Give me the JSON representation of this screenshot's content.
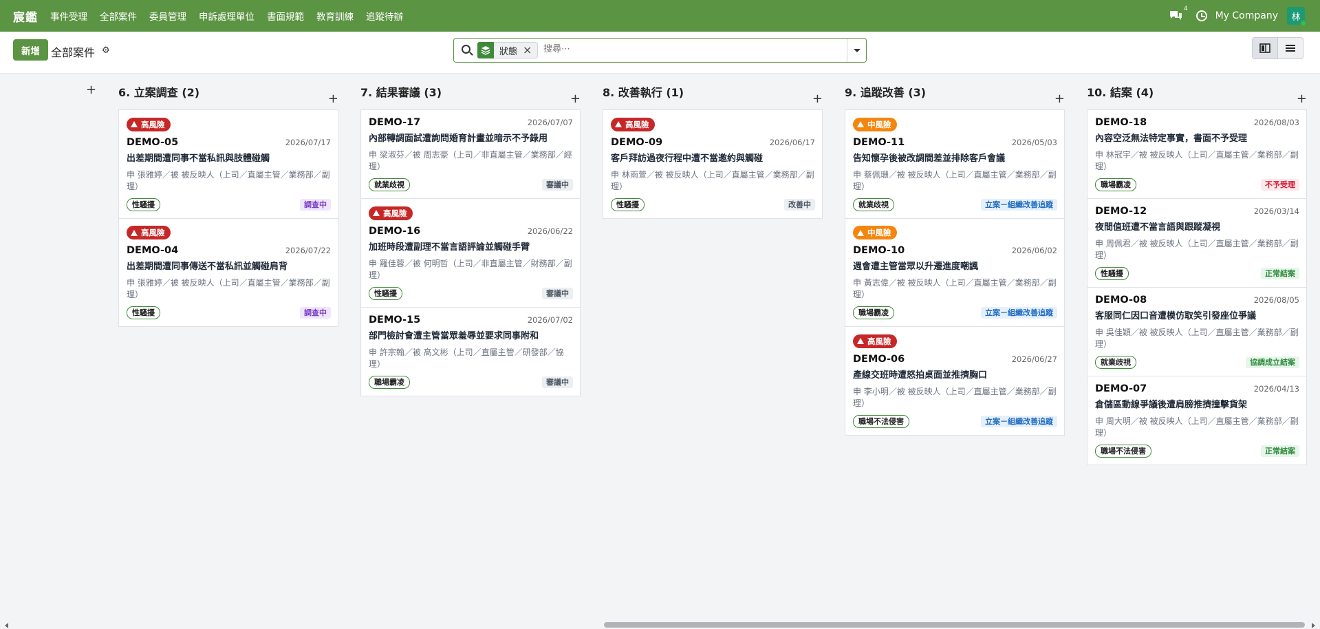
{
  "nav": {
    "brand": "宸鑑",
    "menu": [
      "事件受理",
      "全部案件",
      "委員管理",
      "申訴處理單位",
      "書面規範",
      "教育訓練",
      "追蹤待辦"
    ],
    "chat_count": "4",
    "company": "My Company",
    "avatar": "林"
  },
  "control": {
    "new_label": "新增",
    "title": "全部案件",
    "facet_label": "狀態",
    "search_placeholder": "搜尋⋯"
  },
  "columns": [
    {
      "title": "6. 立案調查 (2)",
      "cards": [
        {
          "risk": "高風險",
          "risk_level": "high",
          "id": "DEMO-05",
          "date": "2026/07/17",
          "title": "出差期間遭同事不當私訊與肢體碰觸",
          "meta": "申 張雅婷／被 被反映人（上司／直屬主管／業務部／副理）",
          "tag": "性騷擾",
          "status": "調查中",
          "status_kind": "inv"
        },
        {
          "risk": "高風險",
          "risk_level": "high",
          "id": "DEMO-04",
          "date": "2026/07/22",
          "title": "出差期間遭同事傳送不當私訊並觸碰肩背",
          "meta": "申 張雅婷／被 被反映人（上司／直屬主管／業務部／副理）",
          "tag": "性騷擾",
          "status": "調查中",
          "status_kind": "inv"
        }
      ]
    },
    {
      "title": "7. 結果審議 (3)",
      "cards": [
        {
          "risk": "",
          "risk_level": "",
          "id": "DEMO-17",
          "date": "2026/07/07",
          "title": "內部轉調面試遭詢問婚育計畫並暗示不予錄用",
          "meta": "申 梁淑芬／被 周志豪（上司／非直屬主管／業務部／經理）",
          "tag": "就業歧視",
          "status": "審議中",
          "status_kind": "rev"
        },
        {
          "risk": "高風險",
          "risk_level": "high",
          "id": "DEMO-16",
          "date": "2026/06/22",
          "title": "加班時段遭副理不當言語評論並觸碰手臂",
          "meta": "申 羅佳蓉／被 何明哲（上司／非直屬主管／財務部／副理）",
          "tag": "性騷擾",
          "status": "審議中",
          "status_kind": "rev"
        },
        {
          "risk": "",
          "risk_level": "",
          "id": "DEMO-15",
          "date": "2026/07/02",
          "title": "部門檢討會遭主管當眾羞辱並要求同事附和",
          "meta": "申 許宗翰／被 高文彬（上司／直屬主管／研發部／協理）",
          "tag": "職場霸凌",
          "status": "審議中",
          "status_kind": "rev"
        }
      ]
    },
    {
      "title": "8. 改善執行 (1)",
      "cards": [
        {
          "risk": "高風險",
          "risk_level": "high",
          "id": "DEMO-09",
          "date": "2026/06/17",
          "title": "客戶拜訪過夜行程中遭不當邀約與觸碰",
          "meta": "申 林雨萱／被 被反映人（上司／直屬主管／業務部／副理）",
          "tag": "性騷擾",
          "status": "改善中",
          "status_kind": "imp"
        }
      ]
    },
    {
      "title": "9. 追蹤改善 (3)",
      "cards": [
        {
          "risk": "中風險",
          "risk_level": "med",
          "id": "DEMO-11",
          "date": "2026/05/03",
          "title": "告知懷孕後被改調間差並排除客戶會議",
          "meta": "申 蔡佩珊／被 被反映人（上司／直屬主管／業務部／副理）",
          "tag": "就業歧視",
          "status": "立案－組織改善追蹤",
          "status_kind": "trk"
        },
        {
          "risk": "中風險",
          "risk_level": "med",
          "id": "DEMO-10",
          "date": "2026/06/02",
          "title": "週會遭主管當眾以升遷進度嘲諷",
          "meta": "申 黃志偉／被 被反映人（上司／直屬主管／業務部／副理）",
          "tag": "職場霸凌",
          "status": "立案－組織改善追蹤",
          "status_kind": "trk"
        },
        {
          "risk": "高風險",
          "risk_level": "high",
          "id": "DEMO-06",
          "date": "2026/06/27",
          "title": "產線交班時遭怒拍桌面並推擠胸口",
          "meta": "申 李小明／被 被反映人（上司／直屬主管／業務部／副理）",
          "tag": "職場不法侵害",
          "status": "立案－組織改善追蹤",
          "status_kind": "trk"
        }
      ]
    },
    {
      "title": "10. 結案 (4)",
      "cards": [
        {
          "risk": "",
          "risk_level": "",
          "id": "DEMO-18",
          "date": "2026/08/03",
          "title": "內容空泛無法特定事實，書面不予受理",
          "meta": "申 林冠宇／被 被反映人（上司／直屬主管／業務部／副理）",
          "tag": "職場霸凌",
          "status": "不予受理",
          "status_kind": "rej"
        },
        {
          "risk": "",
          "risk_level": "",
          "id": "DEMO-12",
          "date": "2026/03/14",
          "title": "夜間值班遭不當言語與跟蹤凝視",
          "meta": "申 周佩君／被 被反映人（上司／直屬主管／業務部／副理）",
          "tag": "性騷擾",
          "status": "正常結案",
          "status_kind": "ok"
        },
        {
          "risk": "",
          "risk_level": "",
          "id": "DEMO-08",
          "date": "2026/08/05",
          "title": "客服同仁因口音遭模仿取笑引發座位爭議",
          "meta": "申 吳佳穎／被 被反映人（上司／直屬主管／業務部／副理）",
          "tag": "就業歧視",
          "status": "協調成立結案",
          "status_kind": "ok"
        },
        {
          "risk": "",
          "risk_level": "",
          "id": "DEMO-07",
          "date": "2026/04/13",
          "title": "倉儲區動線爭議後遭肩膀推擠撞擊貨架",
          "meta": "申 周大明／被 被反映人（上司／直屬主管／業務部／副理）",
          "tag": "職場不法侵害",
          "status": "正常結案",
          "status_kind": "ok"
        }
      ]
    }
  ],
  "colors": {
    "brand": "#5b9442",
    "high_risk": "#c62828",
    "med_risk": "#f4860e"
  }
}
